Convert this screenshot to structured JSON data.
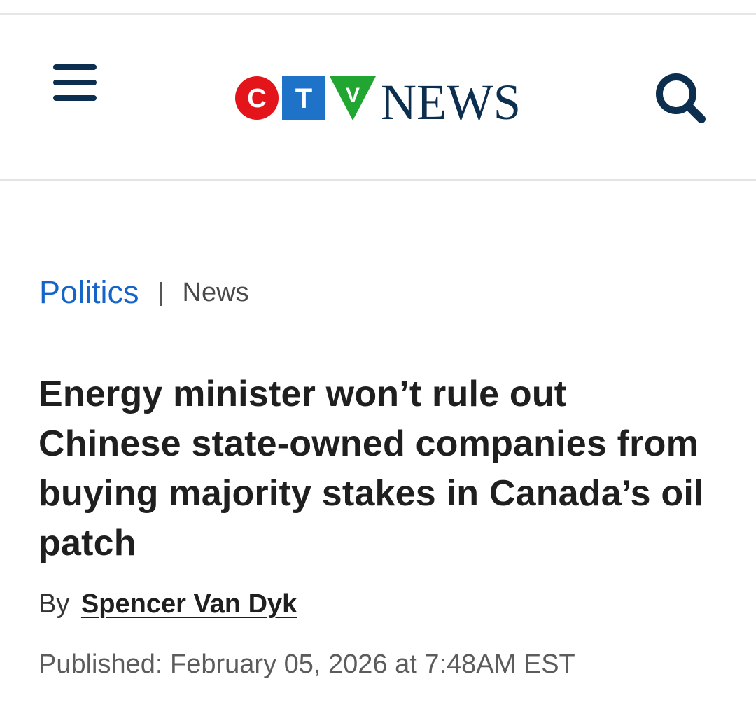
{
  "header": {
    "logo": {
      "letters": [
        "C",
        "T",
        "V"
      ],
      "wordmark": "NEWS",
      "colors": {
        "c": "#e3151b",
        "t": "#1e72c8",
        "v": "#22a632",
        "wordmark": "#0d2f4f"
      }
    },
    "menu_icon": "hamburger-menu-icon",
    "search_icon": "search-icon",
    "icon_color": "#0d2f4f"
  },
  "breadcrumb": {
    "section": "Politics",
    "separator": "|",
    "type": "News"
  },
  "article": {
    "headline": "Energy minister won’t rule out Chinese state-owned companies from buying majority stakes in Canada’s oil patch",
    "byline_prefix": "By",
    "author": "Spencer Van Dyk",
    "published": "Published: February 05, 2026 at 7:48AM EST"
  },
  "colors": {
    "section_link": "#1565c9",
    "headline": "#1f1f1f",
    "meta_text": "#5c5c5c"
  }
}
